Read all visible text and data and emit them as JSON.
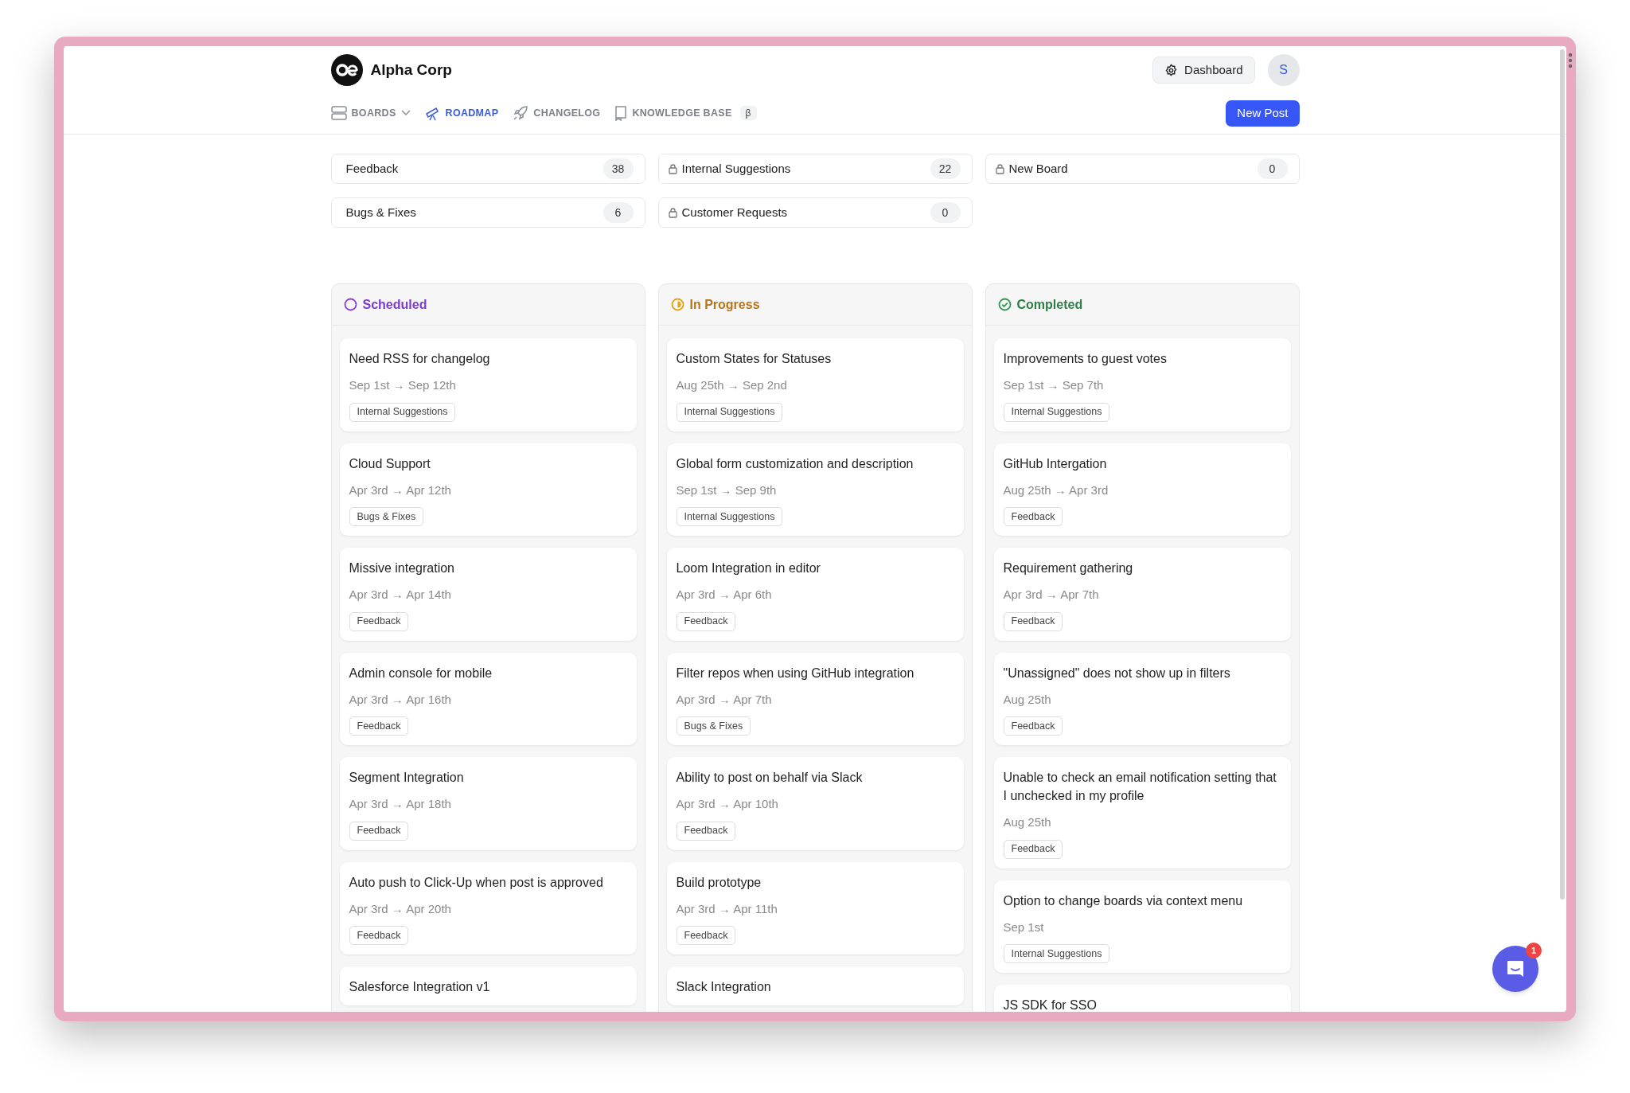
{
  "brand": {
    "name": "Alpha Corp"
  },
  "header": {
    "dashboard": "Dashboard",
    "avatar": "S"
  },
  "nav": [
    {
      "label": "BOARDS",
      "kind": "boards",
      "selected": false
    },
    {
      "label": "ROADMAP",
      "kind": "roadmap",
      "selected": true
    },
    {
      "label": "CHANGELOG",
      "kind": "changelog",
      "selected": false
    },
    {
      "label": "KNOWLEDGE BASE",
      "kind": "knowledge",
      "selected": false,
      "badge": "β"
    }
  ],
  "new_post": "New Post",
  "boards": [
    {
      "name": "Feedback",
      "count": "38",
      "locked": false
    },
    {
      "name": "Internal Suggestions",
      "count": "22",
      "locked": true
    },
    {
      "name": "New Board",
      "count": "0",
      "locked": true
    },
    {
      "name": "Bugs & Fixes",
      "count": "6",
      "locked": false
    },
    {
      "name": "Customer Requests",
      "count": "0",
      "locked": true
    }
  ],
  "columns": [
    {
      "title": "Scheduled",
      "kind": "scheduled",
      "cards": [
        {
          "title": "Need RSS for changelog",
          "dates": "Sep 1st → Sep 12th",
          "tag": "Internal Suggestions"
        },
        {
          "title": "Cloud Support",
          "dates": "Apr 3rd → Apr 12th",
          "tag": "Bugs & Fixes"
        },
        {
          "title": "Missive integration",
          "dates": "Apr 3rd → Apr 14th",
          "tag": "Feedback"
        },
        {
          "title": "Admin console for mobile",
          "dates": "Apr 3rd → Apr 16th",
          "tag": "Feedback"
        },
        {
          "title": "Segment Integration",
          "dates": "Apr 3rd → Apr 18th",
          "tag": "Feedback"
        },
        {
          "title": "Auto push to Click-Up when post is approved",
          "dates": "Apr 3rd → Apr 20th",
          "tag": "Feedback"
        },
        {
          "title": "Salesforce Integration v1"
        }
      ]
    },
    {
      "title": "In Progress",
      "kind": "in_progress",
      "cards": [
        {
          "title": "Custom States for Statuses",
          "dates": "Aug 25th → Sep 2nd",
          "tag": "Internal Suggestions"
        },
        {
          "title": "Global form customization and description",
          "dates": "Sep 1st → Sep 9th",
          "tag": "Internal Suggestions"
        },
        {
          "title": "Loom Integration in editor",
          "dates": "Apr 3rd → Apr 6th",
          "tag": "Feedback"
        },
        {
          "title": "Filter repos when using GitHub integration",
          "dates": "Apr 3rd → Apr 7th",
          "tag": "Bugs & Fixes"
        },
        {
          "title": "Ability to post on behalf via Slack",
          "dates": "Apr 3rd → Apr 10th",
          "tag": "Feedback"
        },
        {
          "title": "Build prototype",
          "dates": "Apr 3rd → Apr 11th",
          "tag": "Feedback"
        },
        {
          "title": "Slack Integration"
        }
      ]
    },
    {
      "title": "Completed",
      "kind": "completed",
      "cards": [
        {
          "title": "Improvements to guest votes",
          "dates": "Sep 1st → Sep 7th",
          "tag": "Internal Suggestions"
        },
        {
          "title": "GitHub Intergation",
          "dates": "Aug 25th → Apr 3rd",
          "tag": "Feedback"
        },
        {
          "title": "Requirement gathering",
          "dates": "Apr 3rd → Apr 7th",
          "tag": "Feedback"
        },
        {
          "title": "\"Unassigned\" does not show up in filters",
          "dates": "Aug 25th",
          "tag": "Feedback"
        },
        {
          "title": "Unable to check an email notification setting that I unchecked in my profile",
          "dates": "Aug 25th",
          "tag": "Feedback"
        },
        {
          "title": "Option to change boards via context menu",
          "dates": "Sep 1st",
          "tag": "Internal Suggestions"
        },
        {
          "title": "JS SDK for SSO"
        }
      ]
    }
  ],
  "chat": {
    "badge": "1"
  }
}
